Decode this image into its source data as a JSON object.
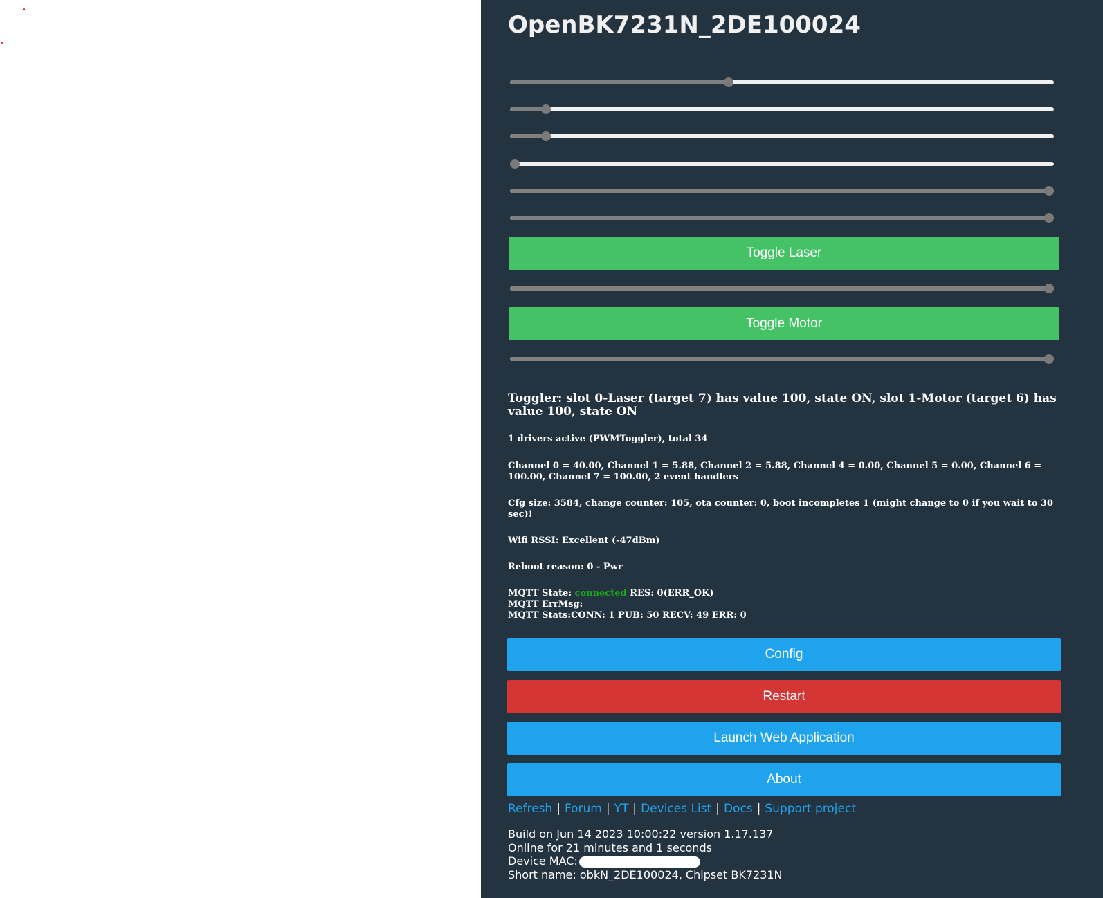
{
  "page": {
    "title": "OpenBK7231N_2DE100024"
  },
  "sliders": [
    {
      "name": "slider-channel-0",
      "value": 40
    },
    {
      "name": "slider-channel-1",
      "value": 5.88
    },
    {
      "name": "slider-channel-2",
      "value": 5.88
    },
    {
      "name": "slider-channel-4",
      "value": 0
    },
    {
      "name": "slider-channel-5",
      "value": 100
    },
    {
      "name": "slider-channel-6",
      "value": 100
    }
  ],
  "toggler_sliders": [
    {
      "name": "slider-laser",
      "value": 100
    },
    {
      "name": "slider-motor",
      "value": 100
    }
  ],
  "buttons": {
    "toggle_laser": "Toggle Laser",
    "toggle_motor": "Toggle Motor",
    "config": "Config",
    "restart": "Restart",
    "launch_web_app": "Launch Web Application",
    "about": "About"
  },
  "status": {
    "toggler": "Toggler: slot 0-Laser (target 7) has value 100, state ON, slot 1-Motor (target 6) has value 100, state ON",
    "drivers": "1 drivers active (PWMToggler), total 34",
    "channels": "Channel 0 = 40.00, Channel 1 = 5.88, Channel 2 = 5.88, Channel 4 = 0.00, Channel 5 = 0.00, Channel 6 = 100.00, Channel 7 = 100.00, 2 event handlers",
    "cfg": "Cfg size: 3584, change counter: 105, ota counter: 0, boot incompletes 1 (might change to 0 if you wait to 30 sec)!",
    "wifi": "Wifi RSSI: Excellent (-47dBm)",
    "reboot": "Reboot reason: 0 - Pwr",
    "mqtt_state_label": "MQTT State: ",
    "mqtt_state_value": "connected",
    "mqtt_res": " RES: 0(ERR_OK)",
    "mqtt_errmsg": "MQTT ErrMsg:",
    "mqtt_stats": "MQTT Stats:CONN: 1 PUB: 50 RECV: 49 ERR: 0"
  },
  "links": {
    "refresh": "Refresh",
    "forum": "Forum",
    "yt": "YT",
    "devices_list": "Devices List",
    "docs": "Docs",
    "support": "Support project",
    "separator": "|"
  },
  "footer": {
    "build": "Build on Jun 14 2023 10:00:22 version 1.17.137",
    "online": "Online for 21 minutes and 1 seconds",
    "mac_label": "Device MAC:",
    "short_name": "Short name: obkN_2DE100024, Chipset BK7231N"
  },
  "colors": {
    "panel_bg": "#233340",
    "green_button": "#45c266",
    "blue_button": "#1fa3ec",
    "red_button": "#d43535",
    "connected": "#1aa51a",
    "link": "#1fa3ec"
  }
}
